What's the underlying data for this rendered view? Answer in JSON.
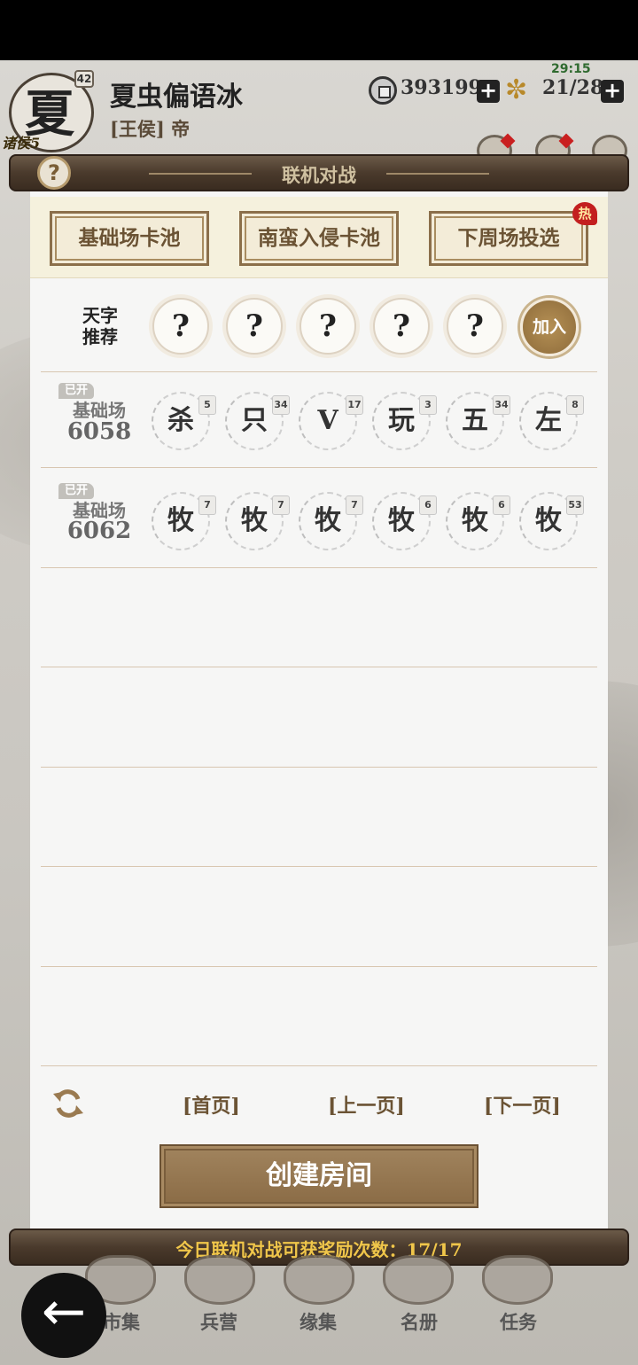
{
  "header": {
    "seal_char": "夏",
    "seal_level": "42",
    "seal_rank": "诸侯5",
    "player_name": "夏虫偏语冰",
    "player_title": "[王侯] 帝",
    "coins": "393199",
    "stamina": "21/28",
    "timer": "29:15"
  },
  "panel": {
    "title": "联机对战",
    "help": "?"
  },
  "tabs": [
    {
      "label": "基础场卡池"
    },
    {
      "label": "南蛮入侵卡池"
    },
    {
      "label": "下周场投选",
      "badge": "热"
    }
  ],
  "recommend": {
    "label_line1": "天字",
    "label_line2": "推荐",
    "slots": [
      "?",
      "?",
      "?",
      "?",
      "?"
    ],
    "join_label": "加入"
  },
  "rooms": [
    {
      "tag": "已开",
      "type": "基础场",
      "id": "6058",
      "cards": [
        {
          "name": "杀",
          "level": "5"
        },
        {
          "name": "只",
          "level": "34"
        },
        {
          "name": "V",
          "level": "17"
        },
        {
          "name": "玩",
          "level": "3"
        },
        {
          "name": "五",
          "level": "34"
        },
        {
          "name": "左",
          "level": "8"
        }
      ]
    },
    {
      "tag": "已开",
      "type": "基础场",
      "id": "6062",
      "cards": [
        {
          "name": "牧",
          "level": "7"
        },
        {
          "name": "牧",
          "level": "7"
        },
        {
          "name": "牧",
          "level": "7"
        },
        {
          "name": "牧",
          "level": "6"
        },
        {
          "name": "牧",
          "level": "6"
        },
        {
          "name": "牧",
          "level": "53"
        }
      ]
    }
  ],
  "pagination": {
    "first": "[首页]",
    "prev": "[上一页]",
    "next": "[下一页]"
  },
  "create_room": "创建房间",
  "reward_text": "今日联机对战可获奖励次数：17/17",
  "bottom_nav": [
    {
      "label": "市集"
    },
    {
      "label": "兵营"
    },
    {
      "label": "缘集"
    },
    {
      "label": "名册"
    },
    {
      "label": "任务"
    }
  ],
  "colors": {
    "accent_brown": "#8a6b45",
    "gold_text": "#f0c64a",
    "hot_red": "#c31f1f"
  }
}
